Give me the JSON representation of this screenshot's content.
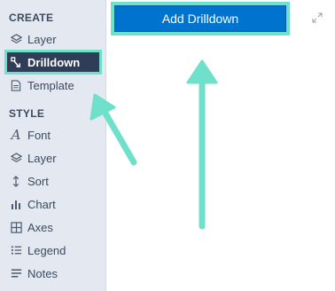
{
  "sidebar": {
    "create_title": "CREATE",
    "style_title": "STYLE",
    "create_items": [
      {
        "label": "Layer",
        "icon": "layers-icon"
      },
      {
        "label": "Drilldown",
        "icon": "drilldown-icon",
        "active": true
      },
      {
        "label": "Template",
        "icon": "template-icon"
      }
    ],
    "style_items": [
      {
        "label": "Font",
        "icon": "font-icon"
      },
      {
        "label": "Layer",
        "icon": "layers-icon"
      },
      {
        "label": "Sort",
        "icon": "sort-icon"
      },
      {
        "label": "Chart",
        "icon": "chart-icon"
      },
      {
        "label": "Axes",
        "icon": "axes-icon"
      },
      {
        "label": "Legend",
        "icon": "legend-icon"
      },
      {
        "label": "Notes",
        "icon": "notes-icon"
      }
    ]
  },
  "main": {
    "add_button_label": "Add Drilldown"
  },
  "colors": {
    "highlight": "#6fe0c9",
    "active_bg": "#2f3d58",
    "button_bg": "#0073cf"
  }
}
